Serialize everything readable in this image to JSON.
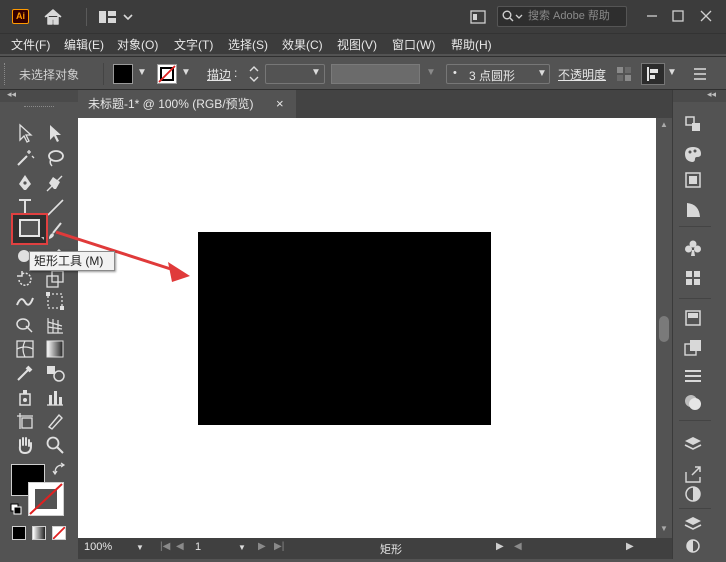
{
  "app": {
    "logo_text": "Ai"
  },
  "search": {
    "placeholder": "搜索 Adobe 帮助"
  },
  "menu": [
    "文件(F)",
    "编辑(E)",
    "对象(O)",
    "文字(T)",
    "选择(S)",
    "效果(C)",
    "视图(V)",
    "窗口(W)",
    "帮助(H)"
  ],
  "control": {
    "selection_label": "未选择对象",
    "stroke_label": "描边",
    "stroke_colon": ":",
    "brush_value": "3 点圆形",
    "brush_bullet": "•",
    "opacity_label": "不透明度"
  },
  "document": {
    "tab_title": "未标题-1* @ 100% (RGB/预览)",
    "tab_close": "×"
  },
  "tooltip": {
    "text": "矩形工具 (M)"
  },
  "status": {
    "zoom": "100%",
    "page": "1",
    "tool_name": "矩形"
  },
  "colors": {
    "accent": "#e04040",
    "rect_fill": "#000000",
    "canvas": "#ffffff",
    "ui_bg": "#535353"
  }
}
